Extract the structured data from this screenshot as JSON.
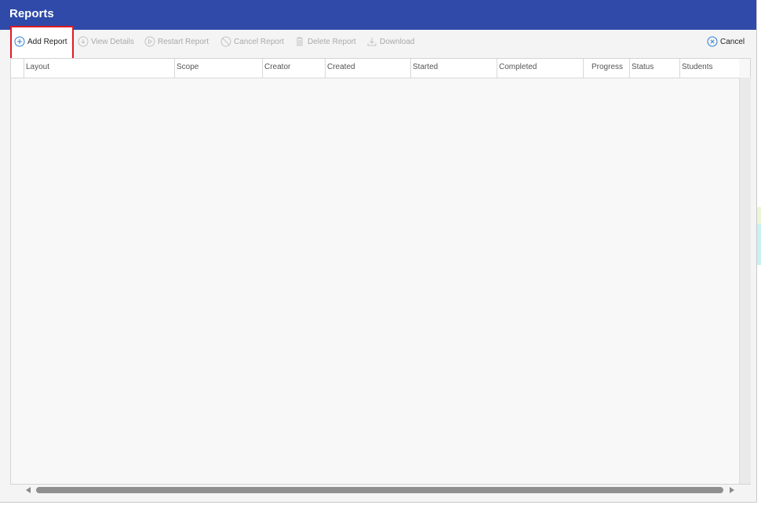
{
  "dialog": {
    "title": "Reports"
  },
  "toolbar": {
    "add_report": "Add Report",
    "view_details": "View Details",
    "restart_report": "Restart Report",
    "cancel_report": "Cancel Report",
    "delete_report": "Delete Report",
    "download": "Download",
    "cancel": "Cancel"
  },
  "grid": {
    "columns": [
      "Layout",
      "Scope",
      "Creator",
      "Created",
      "Started",
      "Completed",
      "Progress",
      "Status",
      "Students"
    ]
  },
  "colors": {
    "title_bar": "#2f4aa8",
    "highlight": "#e01b24",
    "cancel_icon": "#2d7fd3"
  }
}
